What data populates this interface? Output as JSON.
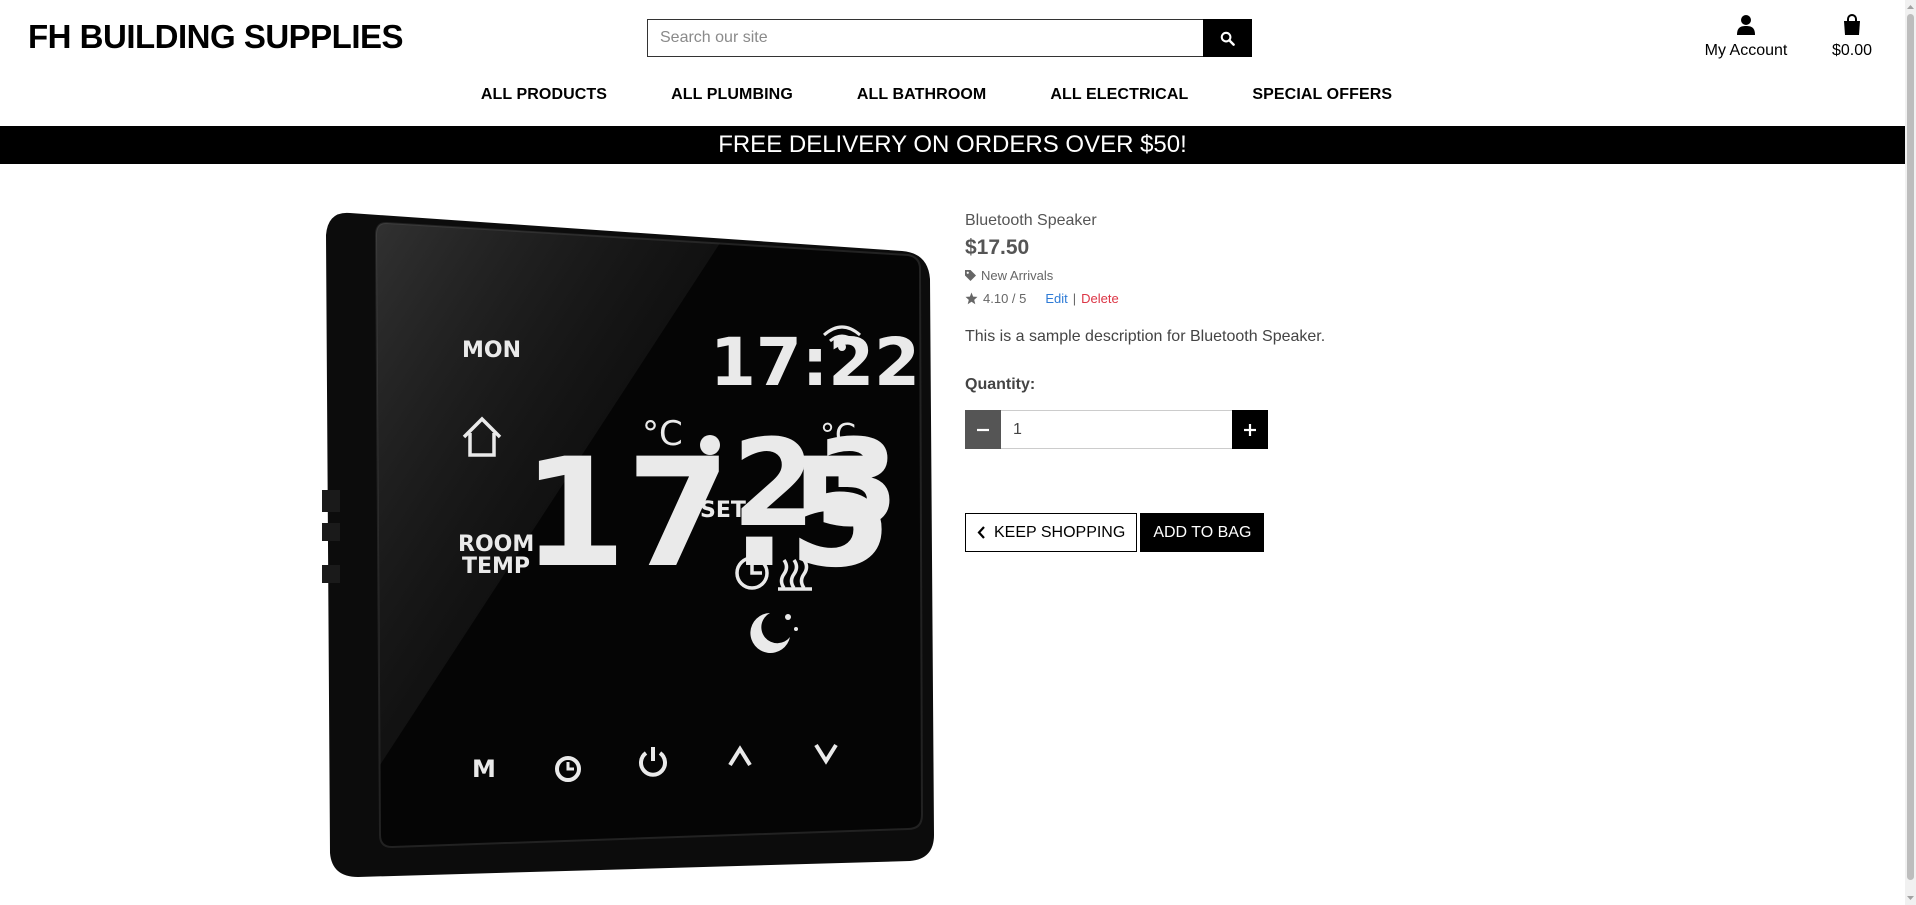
{
  "site": {
    "logo": "FH BUILDING SUPPLIES",
    "search_placeholder": "Search our site",
    "account_label": "My Account",
    "bag_total": "$0.00"
  },
  "nav": {
    "items": [
      "ALL PRODUCTS",
      "ALL PLUMBING",
      "ALL BATHROOM",
      "ALL ELECTRICAL",
      "SPECIAL OFFERS"
    ]
  },
  "banner": {
    "text": "FREE DELIVERY ON ORDERS OVER $50!"
  },
  "product": {
    "name": "Bluetooth Speaker",
    "price": "$17.50",
    "category": "New Arrivals",
    "rating": "4.10 / 5",
    "edit_label": "Edit",
    "separator": "|",
    "delete_label": "Delete",
    "description": "This is a sample description for Bluetooth Speaker.",
    "quantity_label": "Quantity:",
    "quantity_value": "1",
    "keep_shopping_label": "KEEP SHOPPING",
    "add_to_bag_label": "ADD TO BAG",
    "display": {
      "day": "MON",
      "time": "17:22",
      "room_temp": "17.5",
      "set_temp": "23",
      "unit": "°C",
      "set_label": "SET",
      "room_label_1": "ROOM",
      "room_label_2": "TEMP",
      "button_m": "M"
    }
  },
  "colors": {
    "accent": "#000000",
    "edit_link": "#2e7bd6",
    "delete_link": "#dc3545",
    "qty_minus": "#555555"
  }
}
